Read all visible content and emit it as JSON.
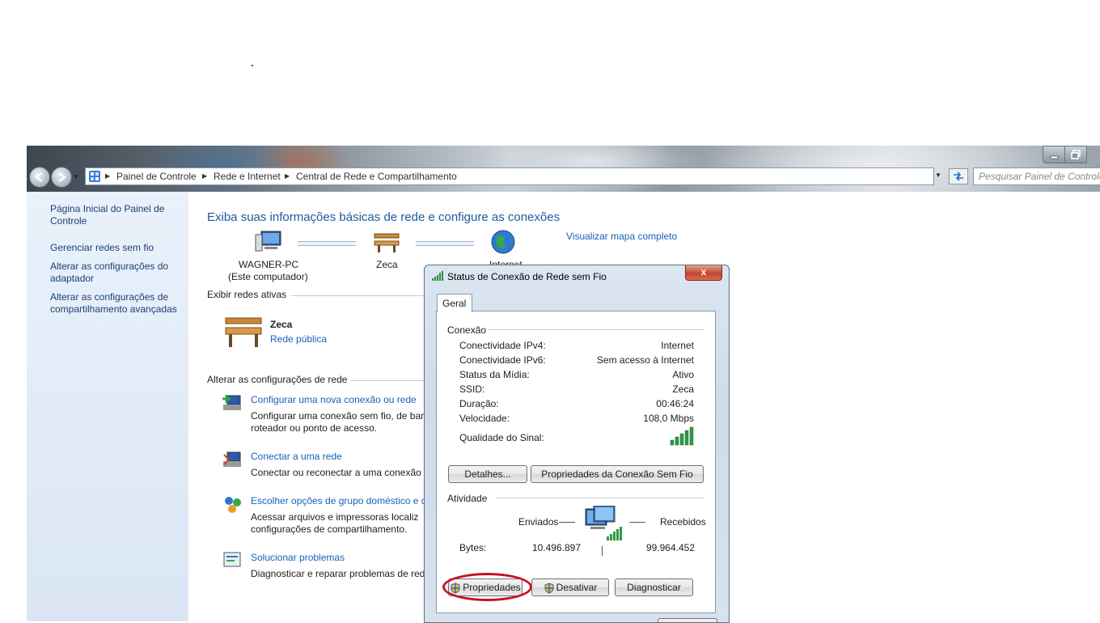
{
  "explorer": {
    "address": {
      "crumbs": [
        "Painel de Controle",
        "Rede e Internet",
        "Central de Rede e Compartilhamento"
      ]
    },
    "search": {
      "placeholder": "Pesquisar Painel de Controle"
    },
    "sidebar": {
      "items": [
        {
          "label": "Página Inicial do Painel de Controle"
        },
        {
          "label": "Gerenciar redes sem fio"
        },
        {
          "label": "Alterar as configurações do adaptador"
        },
        {
          "label": "Alterar as configurações de compartilhamento avançadas"
        }
      ]
    },
    "main": {
      "title": "Exiba suas informações básicas de rede e configure as conexões",
      "map_link": "Visualizar mapa completo",
      "map": {
        "computer_name": "WAGNER-PC",
        "computer_sub": "(Este computador)",
        "network_name": "Zeca",
        "internet_label": "Internet"
      },
      "active_section": "Exibir redes ativas",
      "active_network": {
        "name": "Zeca",
        "type": "Rede pública"
      },
      "change_section": "Alterar as configurações de rede",
      "tasks": [
        {
          "title": "Configurar uma nova conexão ou rede",
          "desc": [
            "Configurar uma conexão sem fio, de ban",
            "roteador ou ponto de acesso."
          ]
        },
        {
          "title": "Conectar a uma rede",
          "desc": [
            "Conectar ou reconectar a uma conexão c"
          ]
        },
        {
          "title": "Escolher opções de grupo doméstico e d",
          "desc": [
            "Acessar arquivos e impressoras localiz",
            "configurações de compartilhamento."
          ]
        },
        {
          "title": "Solucionar problemas",
          "desc": [
            "Diagnosticar e reparar problemas de rede"
          ]
        }
      ]
    }
  },
  "dialog": {
    "title": "Status de Conexão de Rede sem Fio",
    "close_label": "x",
    "tab": "Geral",
    "connection_section": "Conexão",
    "rows": [
      {
        "label": "Conectividade IPv4:",
        "value": "Internet"
      },
      {
        "label": "Conectividade IPv6:",
        "value": "Sem acesso à Internet"
      },
      {
        "label": "Status da Mídia:",
        "value": "Ativo"
      },
      {
        "label": "SSID:",
        "value": "Zeca"
      },
      {
        "label": "Duração:",
        "value": "00:46:24"
      },
      {
        "label": "Velocidade:",
        "value": "108,0 Mbps"
      }
    ],
    "signal_label": "Qualidade do Sinal:",
    "signal_bars": 5,
    "details_button": "Detalhes...",
    "wireless_props_button": "Propriedades da Conexão Sem Fio",
    "activity_section": "Atividade",
    "sent_label": "Enviados",
    "received_label": "Recebidos",
    "bytes_label": "Bytes:",
    "bytes_sent": "10.496.897",
    "bytes_received": "99.964.452",
    "properties_button": "Propriedades",
    "disable_button": "Desativar",
    "diagnose_button": "Diagnosticar"
  },
  "colors": {
    "link": "#1563b8",
    "heading": "#1e5a9e",
    "highlight_circle": "#c8101c"
  }
}
